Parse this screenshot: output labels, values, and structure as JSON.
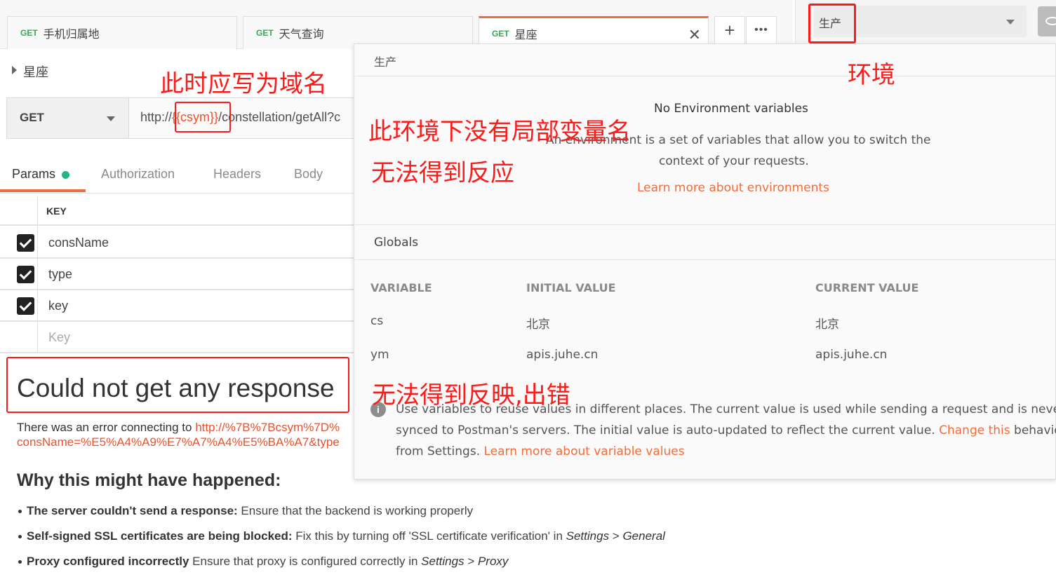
{
  "tabs": [
    {
      "method": "GET",
      "title": "手机归属地"
    },
    {
      "method": "GET",
      "title": "天气查询"
    },
    {
      "method": "GET",
      "title": "星座"
    }
  ],
  "tab_actions": {
    "add": "+",
    "more": "•••",
    "close": "✕"
  },
  "environment": {
    "selected": "生产"
  },
  "request": {
    "name": "星座",
    "method": "GET",
    "url_prefix": "http://",
    "url_variable": "{{csym}}",
    "url_suffix": "/constellation/getAll?c"
  },
  "request_tabs": [
    "Params",
    "Authorization",
    "Headers",
    "Body"
  ],
  "params": {
    "key_header": "KEY",
    "rows": [
      {
        "key": "consName",
        "checked": true
      },
      {
        "key": "type",
        "checked": true
      },
      {
        "key": "key",
        "checked": true
      }
    ],
    "placeholder": "Key"
  },
  "response": {
    "title": "Could not get any response",
    "error_prefix": "There was an error connecting to ",
    "error_link_1": "http://%7B%7Bcsym%7D%",
    "error_link_2": "consName=%E5%A4%A9%E7%A7%A4%E5%BA%A7&type",
    "why_title": "Why this might have happened:",
    "reasons": [
      {
        "bold": "The server couldn't send a response:",
        "text": " Ensure that the backend is working properly",
        "em": "",
        "sep": "",
        "em2": ""
      },
      {
        "bold": "Self-signed SSL certificates are being blocked:",
        "text": " Fix this by turning off 'SSL certificate verification' in ",
        "em": "Settings",
        "sep": " > ",
        "em2": "General"
      },
      {
        "bold": "Proxy configured incorrectly",
        "text": " Ensure that proxy is configured correctly in ",
        "em": "Settings",
        "sep": " > ",
        "em2": "Proxy"
      }
    ]
  },
  "env_popup": {
    "env_name": "生产",
    "no_vars_title": "No Environment variables",
    "desc_line1": "An environment is a set of variables that allow you to switch the",
    "desc_line2": "context of your requests.",
    "learn_env": "Learn more about environments",
    "globals_title": "Globals",
    "columns": [
      "VARIABLE",
      "INITIAL VALUE",
      "CURRENT VALUE"
    ],
    "globals": [
      {
        "variable": "cs",
        "initial": "北京",
        "current": "北京"
      },
      {
        "variable": "ym",
        "initial": "apis.juhe.cn",
        "current": "apis.juhe.cn"
      }
    ],
    "info_line1": "Use variables to reuse values in different places. The current value is used while sending a request and is never",
    "info_line2_a": "synced to Postman's servers. The initial value is auto-updated to reflect the current value. ",
    "info_line2_link": "Change this",
    "info_line2_b": " behaviour",
    "info_line3_a": "from Settings. ",
    "info_line3_link": "Learn more about variable values"
  },
  "annotations": {
    "domain_note": "此时应写为域名",
    "env_note": "环境",
    "no_local_var": "此环境下没有局部变量名",
    "no_reaction": "无法得到反应",
    "no_response_err": "无法得到反映,出错"
  },
  "colors": {
    "accent": "#f26b3a",
    "get_method": "#3aa655",
    "annotation": "#ff1a1a",
    "params_dot": "#26b47f"
  }
}
